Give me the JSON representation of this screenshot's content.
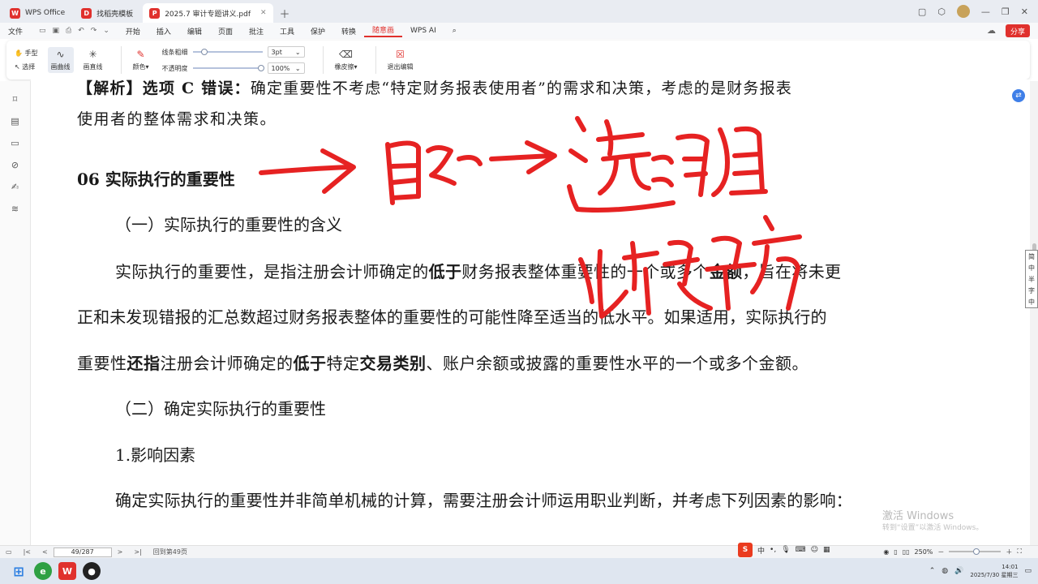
{
  "tabs": [
    {
      "label": "WPS Office",
      "badge": "W",
      "color": "#e0312d",
      "active": false
    },
    {
      "label": "找稻壳模板",
      "badge": "D",
      "color": "#e0312d",
      "active": false
    },
    {
      "label": "2025.7 审计专题讲义.pdf",
      "badge": "P",
      "color": "#e0312d",
      "active": true
    }
  ],
  "menu": {
    "file": "文件",
    "items": [
      "开始",
      "插入",
      "编辑",
      "页面",
      "批注",
      "工具",
      "保护",
      "转换"
    ],
    "active": "随意画",
    "ai": "WPS AI",
    "share": "分享"
  },
  "ribbon": {
    "hand": "手型",
    "select": "选择",
    "curve": "画曲线",
    "line": "画直线",
    "color_label": "颜色",
    "color_value": "#e0312d",
    "thickness_label": "线条粗细",
    "thickness_value": "3pt",
    "opacity_label": "不透明度",
    "opacity_value": "100%",
    "eraser": "橡皮擦",
    "exit": "退出编辑"
  },
  "document": {
    "line1_prefix": "【解析】选项 C 错误：",
    "line1_rest": "确定重要性不考虑“特定财务报表使用者”的需求和决策，考虑的是财务报表",
    "line2": "使用者的整体需求和决策。",
    "heading": "06 实际执行的重要性",
    "sub1": "（一）实际执行的重要性的含义",
    "p1_a": "实际执行的重要性，是指注册会计师确定的",
    "p1_b": "低于",
    "p1_c": "财务报表整体重要性的一个或多个",
    "p1_d": "金额",
    "p1_e": "，旨在将未更",
    "p2": "正和未发现错报的汇总数超过财务报表整体的重要性的可能性降至适当的低水平。如果适用，实际执行的",
    "p3_a": "重要性",
    "p3_b": "还指",
    "p3_c": "注册会计师确定的",
    "p3_d": "低于",
    "p3_e": "特定",
    "p3_f": "交易类别",
    "p3_g": "、账户余额或披露的重要性水平的一个或多个金额。",
    "sub2": "（二）确定实际执行的重要性",
    "sub3": "1.影响因素",
    "p4": "确定实际执行的重要性并非简单机械的计算，需要注册会计师运用职业判断，并考虑下列因素的影响："
  },
  "side_tool_chars": [
    "简",
    "中",
    "半",
    "字",
    "中"
  ],
  "watermark": {
    "title": "激活 Windows",
    "sub": "转到“设置”以激活 Windows。"
  },
  "status": {
    "page": "49/287",
    "goto": "回到第49页",
    "zoom": "250%"
  },
  "ime": {
    "logo": "S",
    "lang": "中"
  },
  "taskbar": {
    "time": "14:01",
    "date": "2025/7/30 星期三"
  }
}
